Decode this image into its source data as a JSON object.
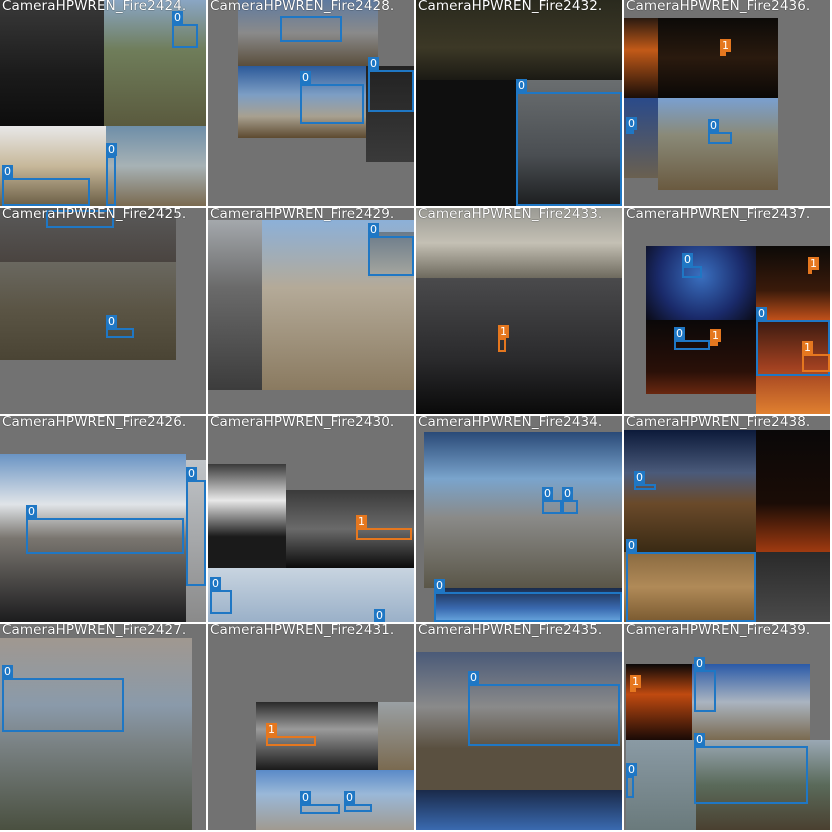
{
  "colors": {
    "class0": "#1f77c4",
    "class1": "#e5771f",
    "pad": "#727272"
  },
  "tiles": [
    {
      "title": "CameraHPWREN_Fire2424."
    },
    {
      "title": "CameraHPWREN_Fire2428."
    },
    {
      "title": "CameraHPWREN_Fire2432."
    },
    {
      "title": "CameraHPWREN_Fire2436."
    },
    {
      "title": "CameraHPWREN_Fire2425."
    },
    {
      "title": "CameraHPWREN_Fire2429."
    },
    {
      "title": "CameraHPWREN_Fire2433."
    },
    {
      "title": "CameraHPWREN_Fire2437."
    },
    {
      "title": "CameraHPWREN_Fire2426."
    },
    {
      "title": "CameraHPWREN_Fire2430."
    },
    {
      "title": "CameraHPWREN_Fire2434."
    },
    {
      "title": "CameraHPWREN_Fire2438."
    },
    {
      "title": "CameraHPWREN_Fire2427."
    },
    {
      "title": "CameraHPWREN_Fire2431."
    },
    {
      "title": "CameraHPWREN_Fire2435."
    },
    {
      "title": "CameraHPWREN_Fire2439."
    }
  ],
  "labels": {
    "zero": "0",
    "one": "1"
  }
}
